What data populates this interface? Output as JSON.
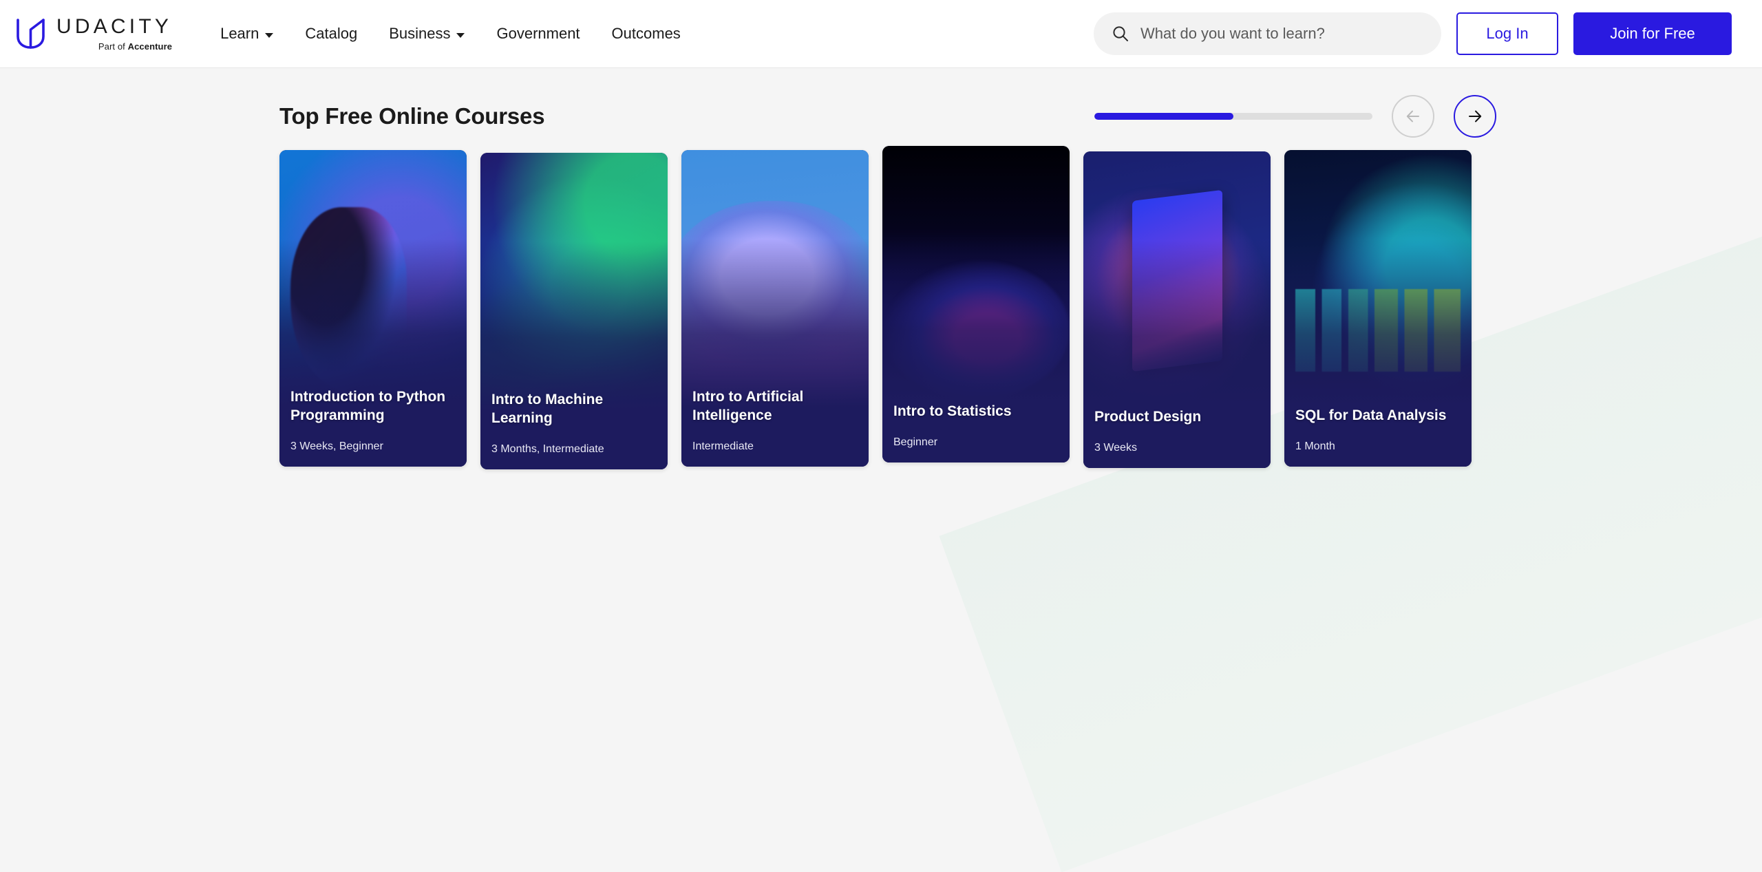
{
  "header": {
    "logo": {
      "wordmark": "UDACITY",
      "subbrand_prefix": "Part of ",
      "subbrand_company": "Accenture"
    },
    "nav": [
      {
        "label": "Learn",
        "has_dropdown": true
      },
      {
        "label": "Catalog",
        "has_dropdown": false
      },
      {
        "label": "Business",
        "has_dropdown": true
      },
      {
        "label": "Government",
        "has_dropdown": false
      },
      {
        "label": "Outcomes",
        "has_dropdown": false
      }
    ],
    "search": {
      "placeholder": "What do you want to learn?",
      "value": "",
      "icon": "search-icon"
    },
    "login_label": "Log In",
    "join_label": "Join for Free"
  },
  "section": {
    "title": "Top Free Online Courses",
    "carousel": {
      "progress_percent": 50,
      "prev_icon": "arrow-left-icon",
      "next_icon": "arrow-right-icon",
      "prev_enabled": false,
      "next_enabled": true
    }
  },
  "courses": [
    {
      "title": "Introduction to Python Programming",
      "meta": "3 Weeks, Beginner",
      "art": "art-python"
    },
    {
      "title": "Intro to Machine Learning",
      "meta": "3 Months, Intermediate",
      "art": "art-ml"
    },
    {
      "title": "Intro to Artificial Intelligence",
      "meta": "Intermediate",
      "art": "art-ai"
    },
    {
      "title": "Intro to Statistics",
      "meta": "Beginner",
      "art": "art-stats"
    },
    {
      "title": "Product Design",
      "meta": "3 Weeks",
      "art": "art-design"
    },
    {
      "title": "SQL for Data Analysis",
      "meta": "1 Month",
      "art": "art-sql"
    }
  ],
  "colors": {
    "brand_blue": "#2a1ae0",
    "page_background": "#f5f5f5",
    "header_background": "#ffffff",
    "card_background": "#1d1b5e",
    "progress_track": "#dedede",
    "disabled_border": "#cfcfcf"
  }
}
